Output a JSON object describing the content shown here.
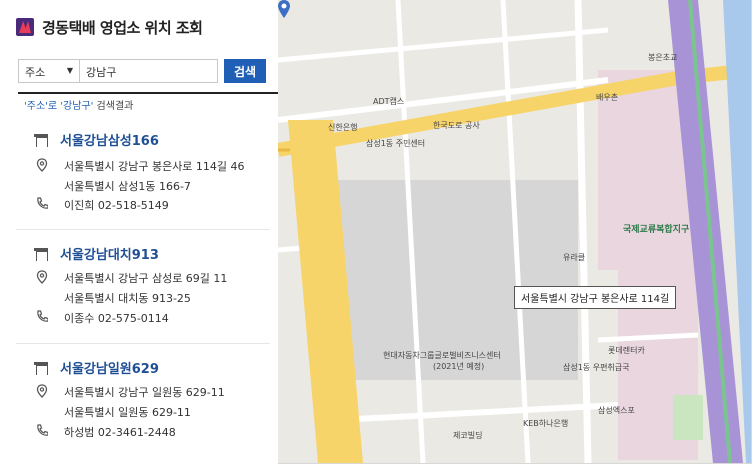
{
  "header": {
    "title": "경동택배 영업소 위치 조회"
  },
  "search": {
    "type_selected": "주소",
    "query": "강남구",
    "button_label": "검색"
  },
  "result_info": {
    "keyword_part": "'주소'로 '강남구'",
    "suffix": " 검색결과"
  },
  "results": [
    {
      "name": "서울강남삼성166",
      "address1": "서울특별시 강남구 봉은사로 114길 46",
      "address2": "서울특별시 삼성1동 166-7",
      "contact": "이진희 02-518-5149"
    },
    {
      "name": "서울강남대치913",
      "address1": "서울특별시 강남구 삼성로 69길 11",
      "address2": "서울특별시 대치동 913-25",
      "contact": "이종수 02-575-0114"
    },
    {
      "name": "서울강남일원629",
      "address1": "서울특별시 강남구 일원동 629-11",
      "address2": "서울특별시 일원동 629-11",
      "contact": "하성범 02-3461-2448"
    }
  ],
  "map": {
    "tooltip": "서울특별시 강남구 봉은사로 114길",
    "labels": {
      "l1": "현대자동차그룹글로벌비즈니스센터",
      "l2": "(2021년 예정)",
      "l3": "삼성1동 주민센터",
      "l4": "국제교류복합지구",
      "l5": "롯데렌터카",
      "l6": "유라클",
      "l7": "KEB하나은행",
      "l8": "신한은행",
      "l9": "ADT캡스",
      "l10": "삼성1동 우편취급국",
      "l11": "한국도로 공사",
      "l12": "봉은초교",
      "l13": "배우촌",
      "l14": "제코빌딩",
      "l15": "삼성엑스포"
    }
  },
  "colors": {
    "accent": "#1f5fb5",
    "name": "#1f4f95",
    "road_yellow": "#f7d46a",
    "road_purple": "#a793d6"
  }
}
